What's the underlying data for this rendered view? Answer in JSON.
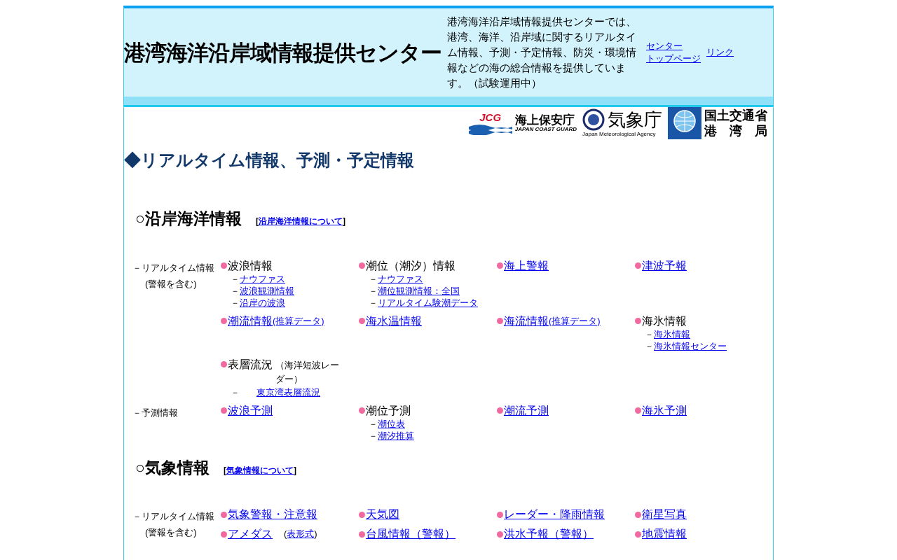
{
  "header": {
    "title": "港湾海洋沿岸域情報提供センター",
    "description": "港湾海洋沿岸域情報提供センターでは、港湾、海洋、沿岸域に関するリアルタイム情報、予測・予定情報、防災・環境情報などの海の総合情報を提供しています。（試験運用中）",
    "links": [
      [
        "センター",
        "トップページ"
      ],
      [
        "リンク"
      ]
    ]
  },
  "logos": [
    {
      "kind": "jcg",
      "mark": "JCG",
      "name": "海上保安庁",
      "english": "JAPAN COAST GUARD"
    },
    {
      "kind": "jma",
      "name": "気象庁",
      "english": "Japan Meteorological Agency"
    },
    {
      "kind": "mlit",
      "name": "国土交通省",
      "sub": "港　湾　局"
    }
  ],
  "page_heading": "◆リアルタイム情報、予測・予定情報",
  "sections": [
    {
      "title": "○沿岸海洋情報",
      "about_open": "[",
      "about_link": "沿岸海洋情報について",
      "about_close": "]",
      "rows": [
        {
          "label": [
            "－リアルタイム情報",
            "(警報を含む)"
          ],
          "items": [
            {
              "title": "波浪情報",
              "linked": false,
              "subitems": [
                {
                  "dash": "－",
                  "text": "ナウファス"
                },
                {
                  "dash": "－",
                  "text": "波浪観測情報"
                },
                {
                  "dash": "－",
                  "text": "沿岸の波浪"
                }
              ]
            },
            {
              "title": "潮位（潮汐）情報",
              "linked": false,
              "subitems": [
                {
                  "dash": "－",
                  "text": "ナウファス"
                },
                {
                  "dash": "－",
                  "text": "潮位観測情報：全国"
                },
                {
                  "dash": "－",
                  "text": "リアルタイム験潮データ"
                }
              ]
            },
            {
              "title": "海上警報",
              "linked": true
            },
            {
              "title": "津波予報",
              "linked": true
            },
            {
              "title": "潮流情報",
              "linked": true,
              "note": [
                {
                  "text": "(推算データ)",
                  "linked": true
                }
              ]
            },
            {
              "title": "海水温情報",
              "linked": true
            },
            {
              "title": "海流情報",
              "linked": true,
              "note": [
                {
                  "text": "(推算データ)",
                  "linked": true
                }
              ]
            },
            {
              "title": "海氷情報",
              "linked": false,
              "subitems": [
                {
                  "dash": "－",
                  "text": "海氷情報"
                },
                {
                  "dash": "－",
                  "text": "海氷情報センター"
                }
              ]
            },
            {
              "title": "表層流況",
              "linked": false,
              "note": [
                {
                  "text": "（海洋短波レーダー）",
                  "linked": false
                }
              ],
              "subitems": [
                {
                  "dash": "－",
                  "text": "東京湾表層流況",
                  "wide": true
                }
              ]
            }
          ]
        },
        {
          "label": [
            "－予測情報"
          ],
          "items": [
            {
              "title": "波浪予測",
              "linked": true
            },
            {
              "title": "潮位予測",
              "linked": false,
              "subitems": [
                {
                  "dash": "－",
                  "text": "潮位表"
                },
                {
                  "dash": "－",
                  "text": "潮汐推算"
                }
              ]
            },
            {
              "title": "潮流予測",
              "linked": true
            },
            {
              "title": "海氷予測",
              "linked": true
            }
          ]
        }
      ]
    },
    {
      "title": "○気象情報",
      "about_open": "[",
      "about_link": "気象情報について",
      "about_close": "]",
      "rows": [
        {
          "label": [
            "－リアルタイム情報",
            "(警報を含む)"
          ],
          "items": [
            {
              "title": "気象警報・注意報",
              "linked": true
            },
            {
              "title": "天気図",
              "linked": true
            },
            {
              "title": "レーダー・降雨情報",
              "linked": true
            },
            {
              "title": "衛星写真",
              "linked": true
            },
            {
              "title": "アメダス",
              "linked": true,
              "note": [
                {
                  "text": "(",
                  "linked": false
                },
                {
                  "text": "表形式",
                  "linked": true
                },
                {
                  "text": ")",
                  "linked": false
                }
              ]
            },
            {
              "title": "台風情報（警報）",
              "linked": true
            },
            {
              "title": "洪水予報（警報）",
              "linked": true
            },
            {
              "title": "地震情報",
              "linked": true
            }
          ]
        }
      ]
    }
  ]
}
